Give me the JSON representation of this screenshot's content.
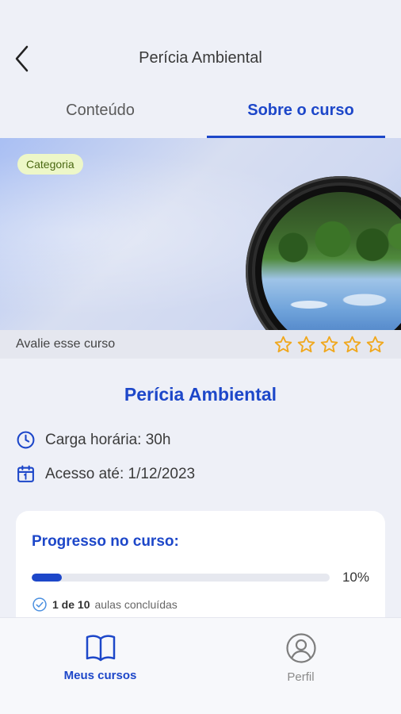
{
  "header": {
    "title": "Perícia Ambiental",
    "back_icon": "chevron-left-icon"
  },
  "tabs": [
    {
      "label": "Conteúdo",
      "active": false
    },
    {
      "label": "Sobre o curso",
      "active": true
    }
  ],
  "banner": {
    "category": "Categoria"
  },
  "rating": {
    "label": "Avalie esse curso",
    "stars_total": 5,
    "stars_filled": 0,
    "star_color": "#f0a81e"
  },
  "course": {
    "title": "Perícia Ambiental",
    "workload": "Carga horária: 30h",
    "access": "Acesso até: 1/12/2023"
  },
  "progress": {
    "title": "Progresso no curso:",
    "value": 0.1,
    "percent_label": "10%",
    "done_count": "1 de 10",
    "done_suffix": "aulas concluídas"
  },
  "nav": {
    "items": [
      {
        "label": "Meus cursos",
        "icon": "book-icon",
        "active": true
      },
      {
        "label": "Perfil",
        "icon": "user-circle-icon",
        "active": false
      }
    ]
  },
  "colors": {
    "primary": "#1d47c9",
    "badge_bg": "#edf7c8"
  }
}
